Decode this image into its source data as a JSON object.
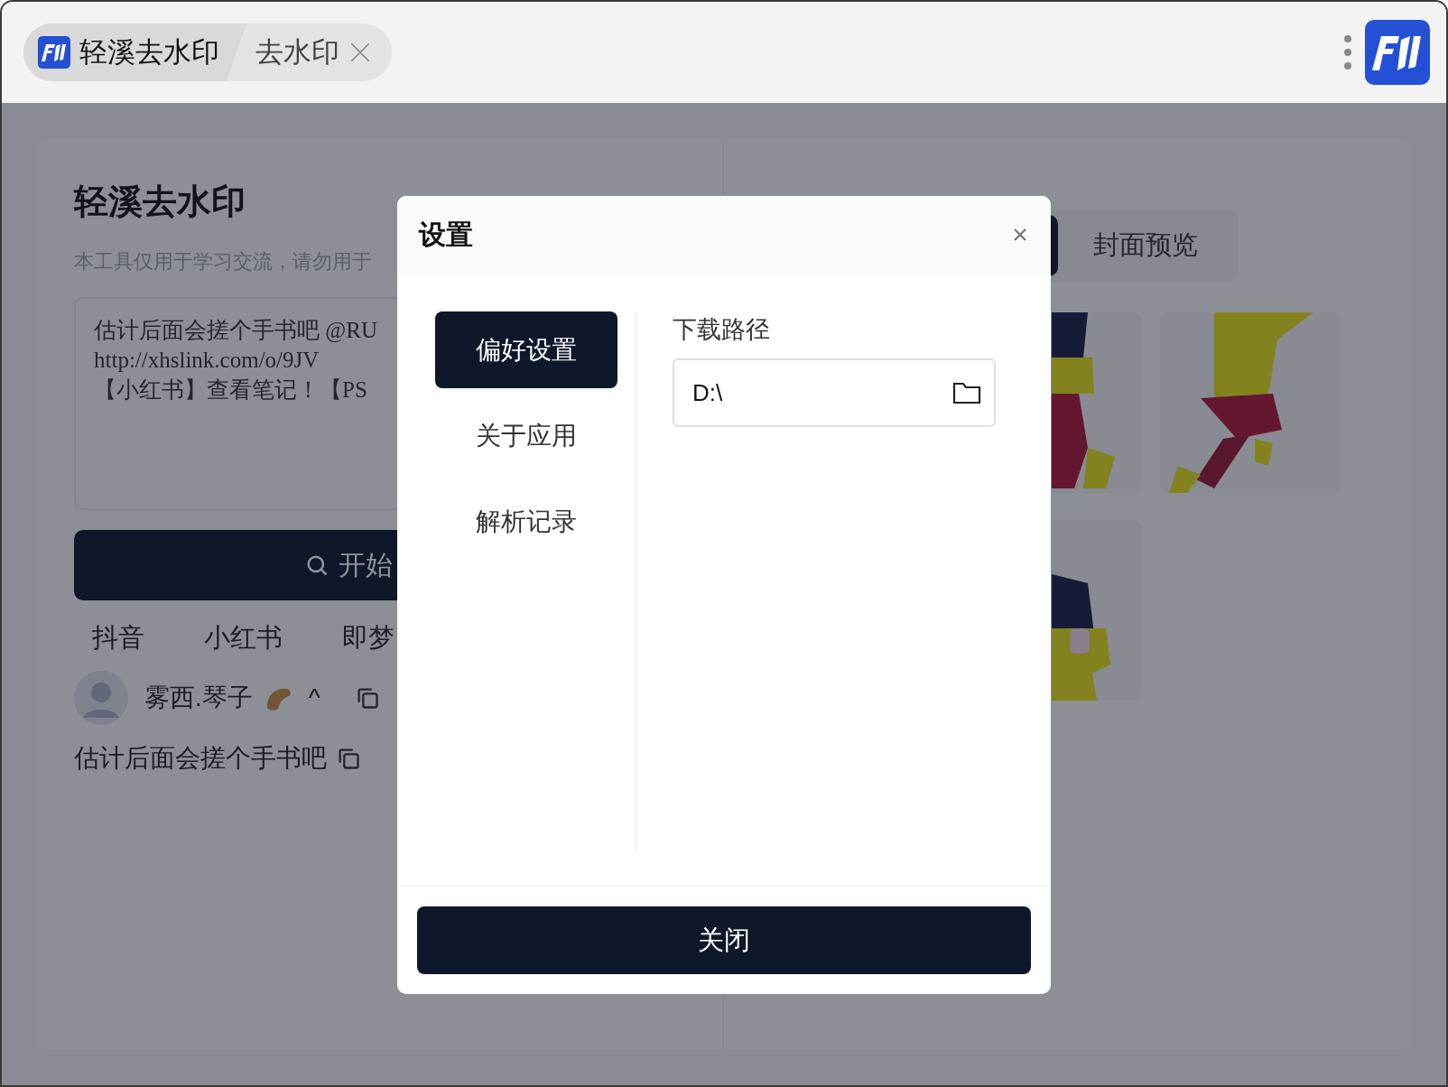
{
  "titlebar": {
    "tabs": [
      {
        "label": "轻溪去水印",
        "selected": true,
        "closable": false
      },
      {
        "label": "去水印",
        "selected": false,
        "closable": true
      }
    ]
  },
  "main": {
    "title": "轻溪去水印",
    "subtitle": "本工具仅用于学习交流，请勿用于",
    "input_lines": [
      "估计后面会搓个手书吧 @RU",
      "http://xhslink.com/o/9JV",
      "【小红书】查看笔记！【PS"
    ],
    "start_button": "开始",
    "platforms": [
      "抖音",
      "小红书",
      "即梦"
    ],
    "author": {
      "name": "雾西.琴子",
      "suffix": "^"
    },
    "description": "估计后面会搓个手书吧"
  },
  "preview": {
    "tabs": [
      {
        "selected": true
      },
      {
        "label": "封面预览",
        "selected": false
      }
    ]
  },
  "dialog": {
    "title": "设置",
    "nav": [
      {
        "label": "偏好设置",
        "selected": true
      },
      {
        "label": "关于应用",
        "selected": false
      },
      {
        "label": "解析记录",
        "selected": false
      }
    ],
    "field_label": "下载路径",
    "field_value": "D:\\",
    "close_button": "关闭"
  }
}
